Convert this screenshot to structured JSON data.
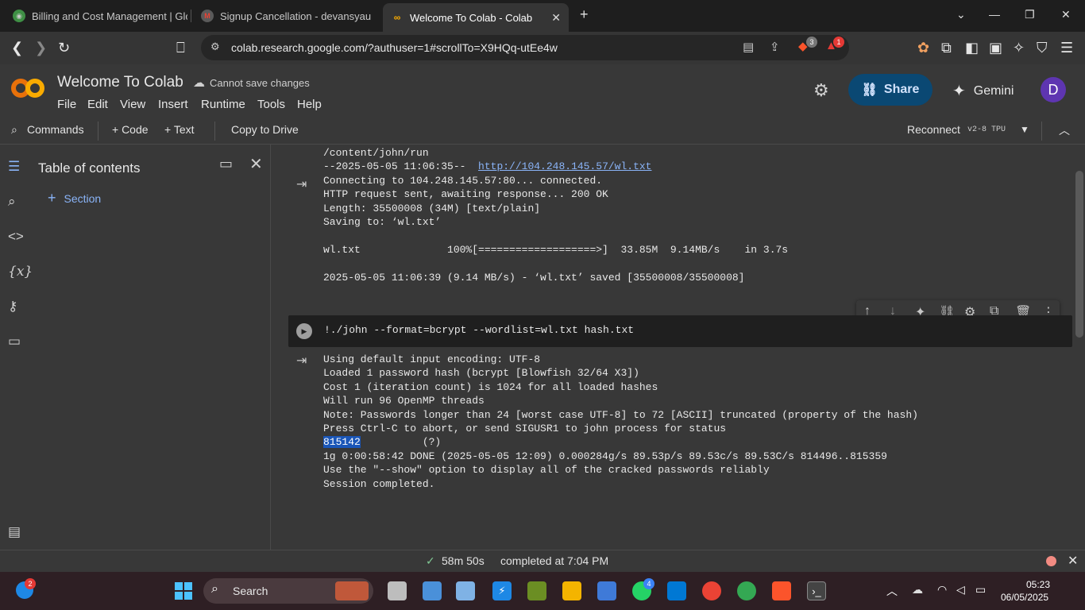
{
  "browser": {
    "tabs": [
      {
        "title": "Billing and Cost Management | Glob",
        "icon": "globe-icon"
      },
      {
        "title": "Signup Cancellation - devansyauqia",
        "icon": "gmail-icon"
      },
      {
        "title": "Welcome To Colab - Colab",
        "icon": "colab-icon"
      }
    ],
    "url": "colab.research.google.com/?authuser=1#scrollTo=X9HQq-utEe4w",
    "brave_badge": "3",
    "alert_badge": "1"
  },
  "colab": {
    "title": "Welcome To Colab",
    "save_status": "Cannot save changes",
    "menu": [
      "File",
      "Edit",
      "View",
      "Insert",
      "Runtime",
      "Tools",
      "Help"
    ],
    "share_label": "Share",
    "gemini_label": "Gemini",
    "avatar_letter": "D",
    "toolbar": {
      "commands": "Commands",
      "code": "+ Code",
      "text": "+ Text",
      "copy_drive": "Copy to Drive",
      "reconnect": "Reconnect",
      "runtime_type": "v2-8 TPU"
    },
    "toc": {
      "title": "Table of contents",
      "section": "Section"
    },
    "output1": {
      "line1": "/content/john/run",
      "line2_prefix": "--2025-05-05 11:06:35--  ",
      "line2_link": "http://104.248.145.57/wl.txt",
      "line3": "Connecting to 104.248.145.57:80... connected.",
      "line4": "HTTP request sent, awaiting response... 200 OK",
      "line5": "Length: 35500008 (34M) [text/plain]",
      "line6": "Saving to: ‘wl.txt’",
      "line7": "wl.txt              100%[===================>]  33.85M  9.14MB/s    in 3.7s",
      "line8": "2025-05-05 11:06:39 (9.14 MB/s) - ‘wl.txt’ saved [35500008/35500008]"
    },
    "cell_code": "!./john --format=bcrypt --wordlist=wl.txt hash.txt",
    "output2": {
      "line1": "Using default input encoding: UTF-8",
      "line2": "Loaded 1 password hash (bcrypt [Blowfish 32/64 X3])",
      "line3": "Cost 1 (iteration count) is 1024 for all loaded hashes",
      "line4": "Will run 96 OpenMP threads",
      "line5": "Note: Passwords longer than 24 [worst case UTF-8] to 72 [ASCII] truncated (property of the hash)",
      "line6": "Press Ctrl-C to abort, or send SIGUSR1 to john process for status",
      "cracked": "815142",
      "cracked_suffix": "          (?)",
      "line8": "1g 0:00:58:42 DONE (2025-05-05 12:09) 0.000284g/s 89.53p/s 89.53c/s 89.53C/s 814496..815359",
      "line9": "Use the \"--show\" option to display all of the cracked passwords reliably",
      "line10": "Session completed."
    },
    "status": {
      "duration": "58m 50s",
      "completed": "completed at 7:04 PM"
    }
  },
  "taskbar": {
    "search_label": "Search",
    "notif_badge": "2",
    "whatsapp_badge": "4",
    "time": "05:23",
    "date": "06/05/2025"
  },
  "colors": {
    "accent": "#8ab4f8",
    "share_bg": "#0a4873",
    "avatar": "#5e35b1",
    "highlight": "#1a56b8"
  }
}
